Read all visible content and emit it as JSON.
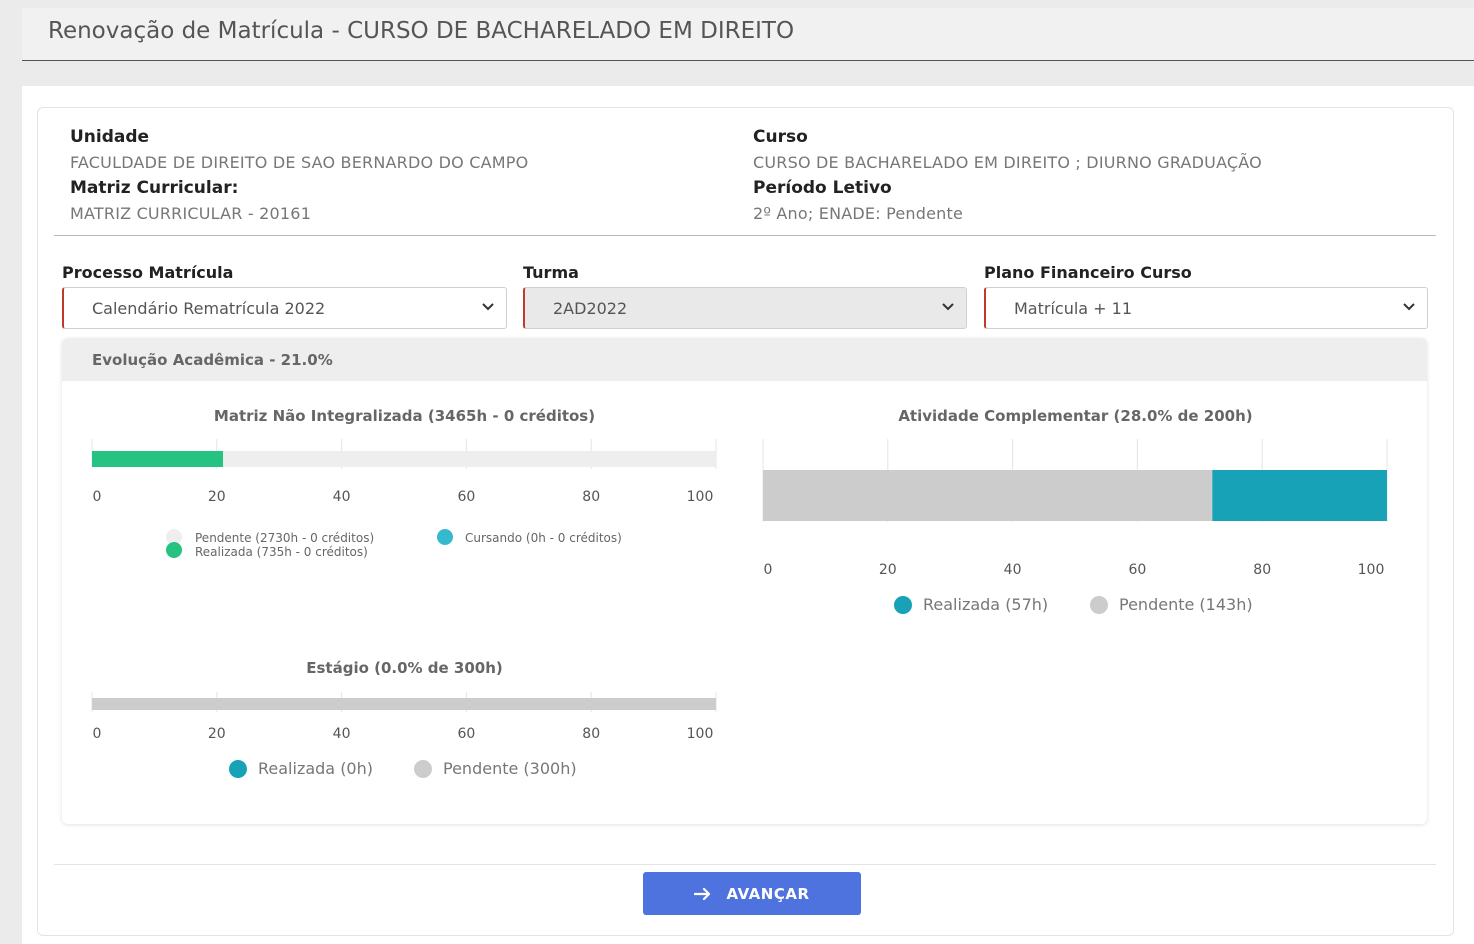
{
  "header": {
    "title": "Renovação de Matrícula - CURSO DE BACHARELADO EM DIREITO"
  },
  "info": {
    "unidade_label": "Unidade",
    "unidade_value": "FACULDADE DE DIREITO DE SAO BERNARDO DO CAMPO",
    "matriz_label": "Matriz Curricular:",
    "matriz_value": "MATRIZ CURRICULAR - 20161",
    "curso_label": "Curso",
    "curso_value": "CURSO DE BACHARELADO EM DIREITO ; DIURNO GRADUAÇÃO",
    "periodo_label": "Período Letivo",
    "periodo_value": "2º Ano; ENADE: Pendente"
  },
  "form": {
    "processo_label": "Processo Matrícula",
    "processo_value": "Calendário Rematrícula 2022",
    "turma_label": "Turma",
    "turma_value": "2AD2022",
    "plano_label": "Plano Financeiro Curso",
    "plano_value": "Matrícula + 11"
  },
  "evolucao": {
    "title": "Evolução Acadêmica - 21.0%"
  },
  "colors": {
    "realizada_green": "#26c281",
    "realizada_teal": "#17a2b8",
    "pendente": "#cccccc",
    "cursando": "#36b9cc",
    "button": "#4e73df"
  },
  "chart_data": [
    {
      "type": "bar",
      "orientation": "horizontal",
      "stacked": true,
      "title": "Matriz Não Integralizada (3465h - 0 créditos)",
      "xlim": [
        0,
        100
      ],
      "ticks": [
        "0",
        "20",
        "40",
        "60",
        "80",
        "100"
      ],
      "series": [
        {
          "name": "Realizada (735h - 0 créditos)",
          "values": [
            21
          ],
          "color": "#26c281"
        },
        {
          "name": "Cursando (0h - 0 créditos)",
          "values": [
            0
          ],
          "color": "#36b9cc"
        },
        {
          "name": "Pendente (2730h - 0 créditos)",
          "values": [
            79
          ],
          "color": "#eeeeee"
        }
      ],
      "legend_order": [
        "Pendente (2730h - 0 créditos)",
        "Cursando (0h - 0 créditos)",
        "Realizada (735h - 0 créditos)"
      ]
    },
    {
      "type": "bar",
      "orientation": "horizontal",
      "stacked": true,
      "title": "Atividade Complementar (28.0% de 200h)",
      "xlim": [
        0,
        100
      ],
      "ticks": [
        "0",
        "20",
        "40",
        "60",
        "80",
        "100"
      ],
      "series": [
        {
          "name": "Pendente (143h)",
          "values": [
            72
          ],
          "color": "#cccccc"
        },
        {
          "name": "Realizada (57h)",
          "values": [
            28
          ],
          "color": "#17a2b8"
        }
      ],
      "legend_order": [
        "Realizada (57h)",
        "Pendente (143h)"
      ]
    },
    {
      "type": "bar",
      "orientation": "horizontal",
      "stacked": true,
      "title": "Estágio (0.0% de 300h)",
      "xlim": [
        0,
        100
      ],
      "ticks": [
        "0",
        "20",
        "40",
        "60",
        "80",
        "100"
      ],
      "series": [
        {
          "name": "Realizada (0h)",
          "values": [
            0
          ],
          "color": "#17a2b8"
        },
        {
          "name": "Pendente (300h)",
          "values": [
            100
          ],
          "color": "#cccccc"
        }
      ],
      "legend_order": [
        "Realizada (0h)",
        "Pendente (300h)"
      ]
    }
  ],
  "actions": {
    "avancar_label": "AVANÇAR",
    "avancar_icon": "arrow-right-icon"
  }
}
